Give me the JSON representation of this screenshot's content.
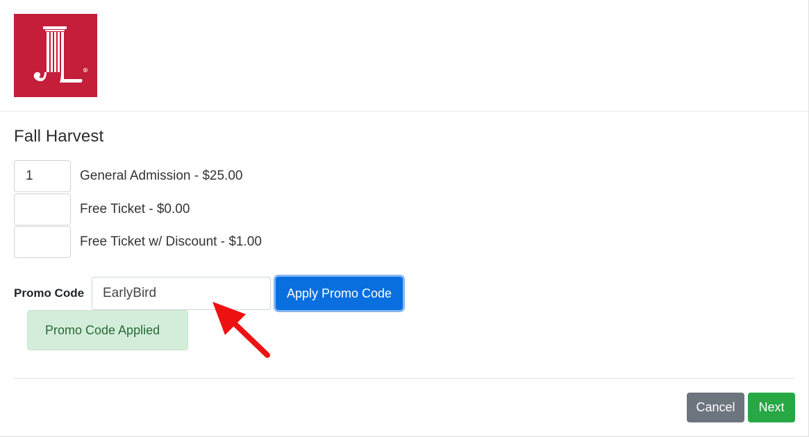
{
  "brand": {
    "logo_name": "junior-league-logo",
    "logo_color": "#c41e3a"
  },
  "event": {
    "title": "Fall Harvest"
  },
  "tickets": [
    {
      "quantity": "1",
      "label": "General Admission - $25.00"
    },
    {
      "quantity": "",
      "label": "Free Ticket - $0.00"
    },
    {
      "quantity": "",
      "label": "Free Ticket w/ Discount - $1.00"
    }
  ],
  "promo": {
    "label": "Promo Code",
    "value": "EarlyBird",
    "apply_label": "Apply Promo Code",
    "status": "Promo Code Applied"
  },
  "annotation": {
    "arrow_color": "#ee1111"
  },
  "footer": {
    "cancel_label": "Cancel",
    "next_label": "Next"
  },
  "colors": {
    "primary": "#0a6fde",
    "success": "#28a745",
    "secondary": "#6c757d",
    "alert_bg": "#d4edda",
    "alert_text": "#276b36"
  }
}
